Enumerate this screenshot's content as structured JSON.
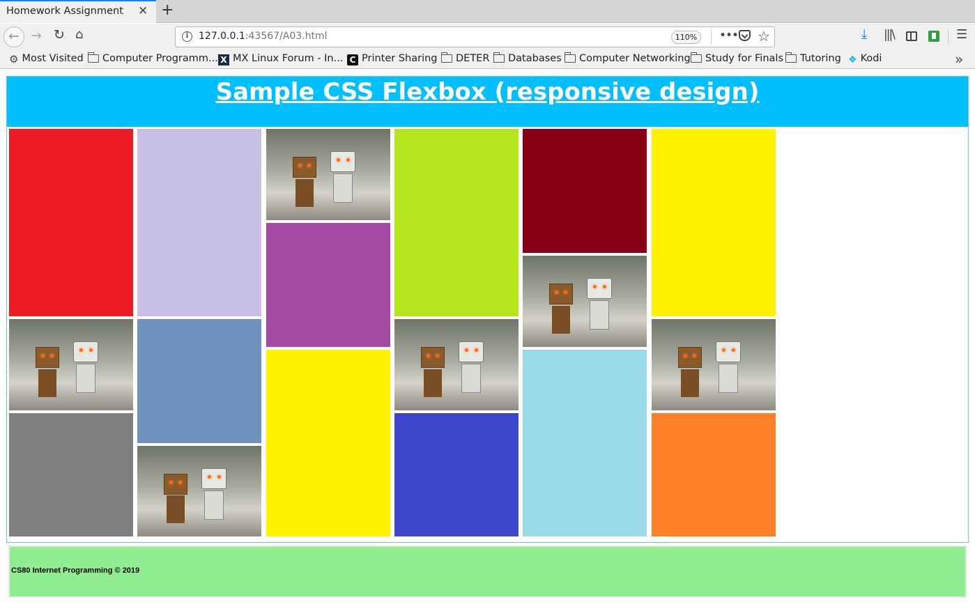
{
  "browser": {
    "tab_title": "Homework Assignment",
    "url_host": "127.0.0.1",
    "url_rest": ":43567/A03.html",
    "zoom": "110%",
    "bookmarks": [
      {
        "label": "Most Visited",
        "icon": "gear-icon"
      },
      {
        "label": "Computer Programm...",
        "icon": "folder-icon"
      },
      {
        "label": "MX Linux Forum - In...",
        "icon": "mx-linux-icon"
      },
      {
        "label": "Printer Sharing",
        "icon": "c-icon"
      },
      {
        "label": "DETER",
        "icon": "folder-icon"
      },
      {
        "label": "Databases",
        "icon": "folder-icon"
      },
      {
        "label": "Computer Networking",
        "icon": "folder-icon"
      },
      {
        "label": "Study for Finals",
        "icon": "folder-icon"
      },
      {
        "label": "Tutoring",
        "icon": "folder-icon"
      },
      {
        "label": "Kodi",
        "icon": "kodi-icon"
      }
    ]
  },
  "page": {
    "title": "Sample CSS Flexbox (responsive design)",
    "footer": "CS80 Internet Programming © 2019",
    "header_color": "#00bfff",
    "footer_color": "#90ee90",
    "columns": [
      [
        {
          "type": "color",
          "color": "#ed1c24"
        },
        {
          "type": "photo"
        },
        {
          "type": "color",
          "color": "#7f7f7f"
        }
      ],
      [
        {
          "type": "color",
          "color": "#c8bfe7"
        },
        {
          "type": "color",
          "color": "#7092be"
        },
        {
          "type": "photo"
        }
      ],
      [
        {
          "type": "photo"
        },
        {
          "type": "color",
          "color": "#a349a4"
        },
        {
          "type": "color",
          "color": "#fff200"
        }
      ],
      [
        {
          "type": "color",
          "color": "#b5e61d"
        },
        {
          "type": "photo"
        },
        {
          "type": "color",
          "color": "#3f48cc"
        }
      ],
      [
        {
          "type": "color",
          "color": "#880015"
        },
        {
          "type": "photo"
        },
        {
          "type": "color",
          "color": "#99d9ea"
        }
      ],
      [
        {
          "type": "color",
          "color": "#fff200"
        },
        {
          "type": "photo"
        },
        {
          "type": "color",
          "color": "#ff7f27"
        }
      ]
    ]
  }
}
